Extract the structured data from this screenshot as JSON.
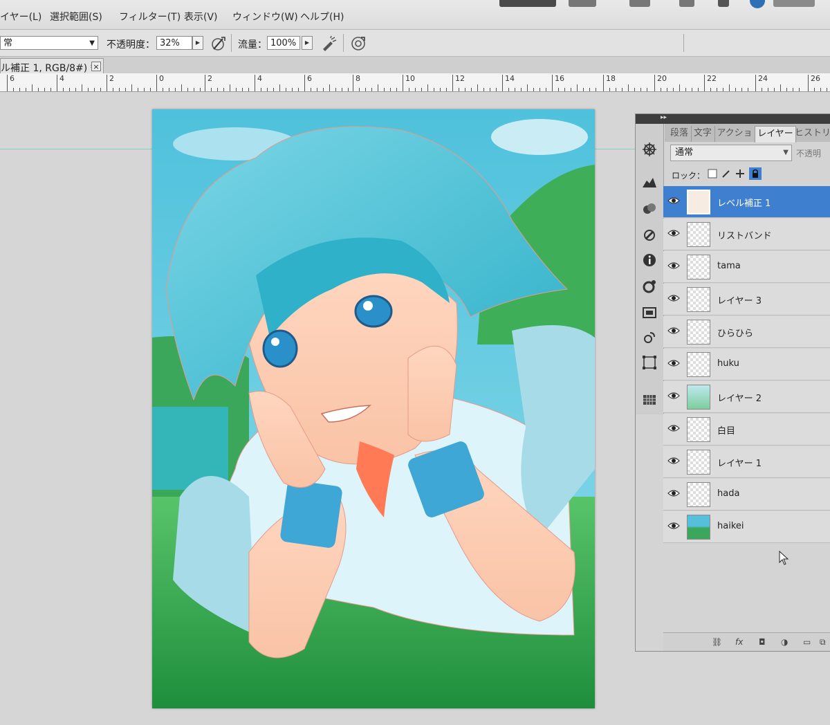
{
  "menu": {
    "items": [
      "イヤー(L)",
      "選択範囲(S)",
      "フィルター(T)",
      "表示(V)",
      "ウィンドウ(W)",
      "ヘルプ(H)"
    ]
  },
  "options": {
    "blend_value": "常",
    "opacity_label": "不透明度：",
    "opacity_value": "32%",
    "flow_label": "流量：",
    "flow_value": "100%"
  },
  "document": {
    "tab_title": "ル補正 1, RGB/8#) *",
    "close_glyph": "×"
  },
  "ruler": {
    "labels": [
      "6",
      "4",
      "2",
      "0",
      "2",
      "4",
      "6",
      "8",
      "10",
      "12",
      "14",
      "16",
      "18",
      "20",
      "22",
      "24",
      "26"
    ]
  },
  "panel": {
    "collapse_glyph": "▸▸",
    "tabs": [
      "段落",
      "文字",
      "アクショ",
      "レイヤー",
      "ヒストリ"
    ],
    "active_tab": "レイヤー",
    "blend_mode": "通常",
    "opacity_label": "不透明",
    "lock_label": "ロック：",
    "layers": [
      {
        "name": "レベル補正 1",
        "selected": true
      },
      {
        "name": "リストバンド",
        "selected": false
      },
      {
        "name": "tama",
        "selected": false
      },
      {
        "name": "レイヤー 3",
        "selected": false
      },
      {
        "name": "ひらひら",
        "selected": false
      },
      {
        "name": "huku",
        "selected": false
      },
      {
        "name": "レイヤー 2",
        "selected": false
      },
      {
        "name": "白目",
        "selected": false
      },
      {
        "name": "レイヤー 1",
        "selected": false
      },
      {
        "name": "hada",
        "selected": false
      },
      {
        "name": "haikei",
        "selected": false
      }
    ],
    "bottom_icons": [
      "link-icon",
      "fx-icon",
      "mask-icon",
      "adjustment-icon",
      "group-icon",
      "new-layer-icon"
    ]
  },
  "colors": {
    "selection": "#3f7fd0",
    "guide": "#7fd3c2",
    "hair": "#3fb8d0",
    "sky": "#5cc6de"
  }
}
